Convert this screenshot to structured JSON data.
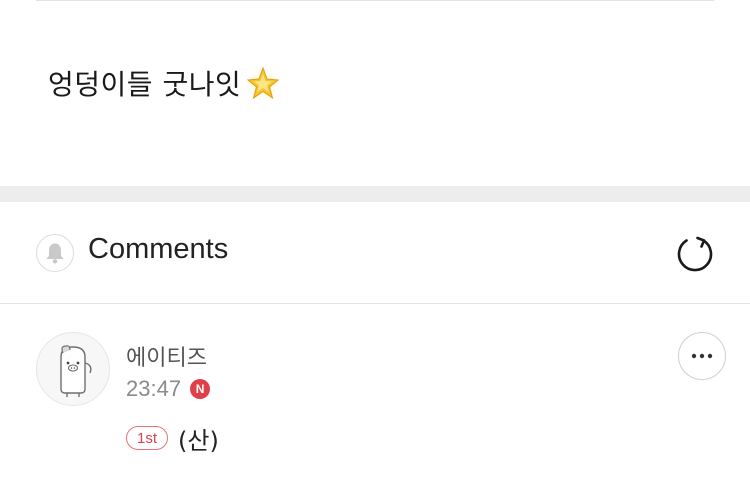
{
  "post": {
    "body_text": "엉덩이들 굿나잇",
    "emoji": "glowing-star"
  },
  "comments_section": {
    "title": "Comments",
    "bell_icon": "bell-icon",
    "refresh_icon": "refresh-icon"
  },
  "comments": [
    {
      "author": "에이티즈",
      "time": "23:47",
      "new_badge": "N",
      "rank_badge": "1st",
      "text": "(산)",
      "more_icon": "more-icon"
    }
  ],
  "colors": {
    "accent_red": "#e0404a",
    "divider": "#e3e3e3",
    "section_gap": "#ededed"
  }
}
